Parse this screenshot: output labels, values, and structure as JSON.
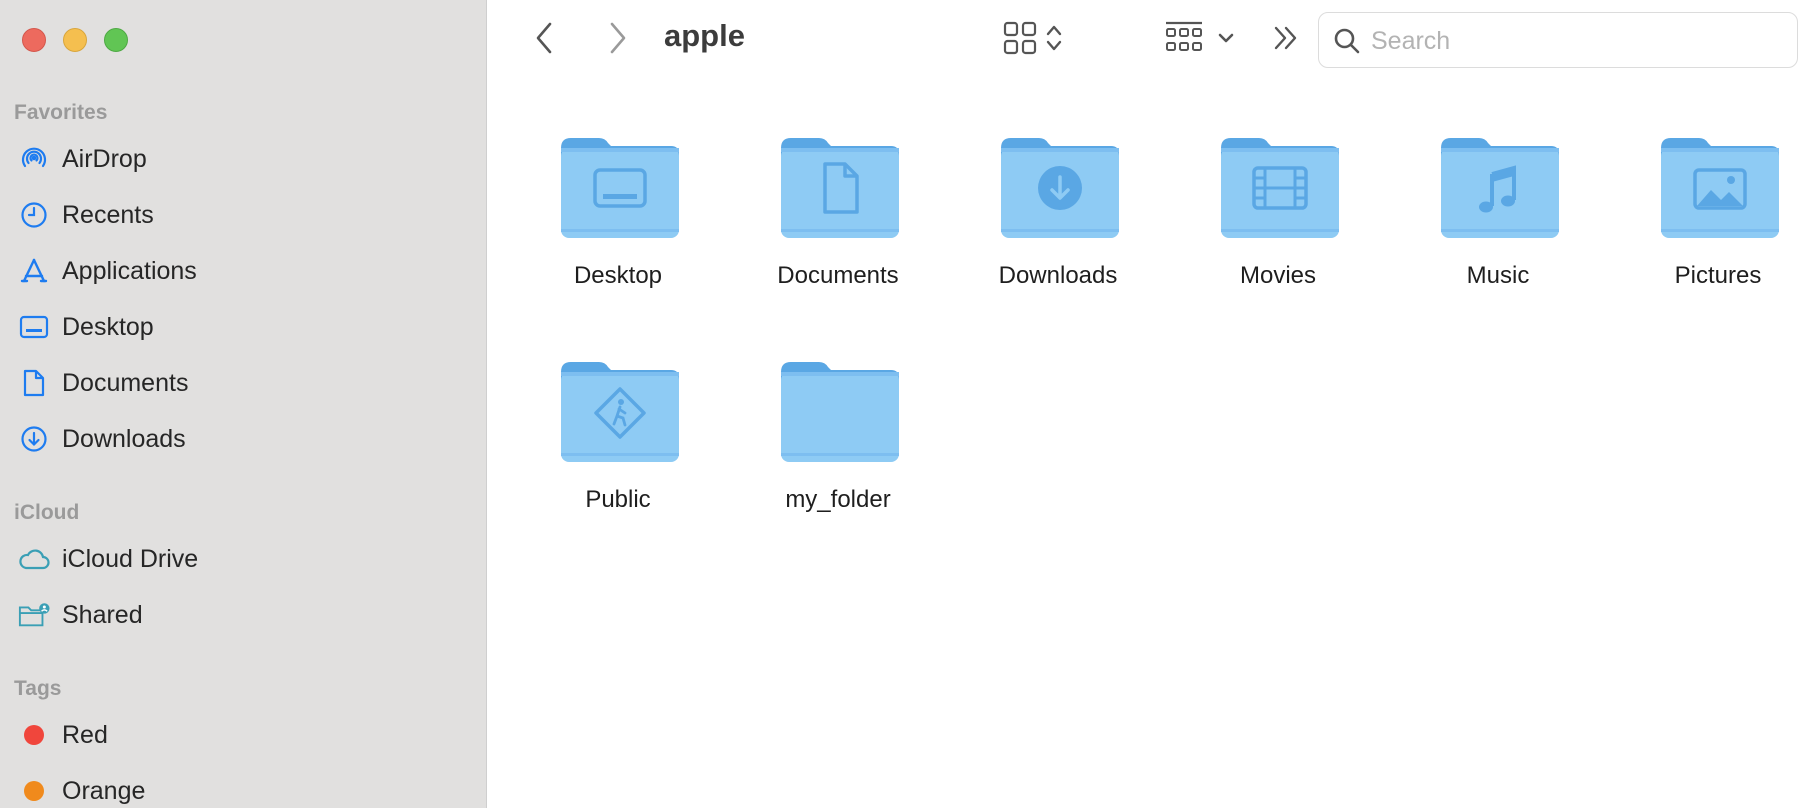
{
  "window": {
    "title": "apple"
  },
  "search": {
    "placeholder": "Search",
    "value": ""
  },
  "sidebar": {
    "favorites_title": "Favorites",
    "favorites": [
      {
        "label": "AirDrop",
        "icon": "airdrop-icon"
      },
      {
        "label": "Recents",
        "icon": "clock-icon"
      },
      {
        "label": "Applications",
        "icon": "applications-icon"
      },
      {
        "label": "Desktop",
        "icon": "desktop-icon"
      },
      {
        "label": "Documents",
        "icon": "document-icon"
      },
      {
        "label": "Downloads",
        "icon": "download-icon"
      }
    ],
    "icloud_title": "iCloud",
    "icloud": [
      {
        "label": "iCloud Drive",
        "icon": "cloud-icon"
      },
      {
        "label": "Shared",
        "icon": "shared-folder-icon"
      }
    ],
    "tags_title": "Tags",
    "tags": [
      {
        "label": "Red",
        "color": "#f0463c"
      },
      {
        "label": "Orange",
        "color": "#f08a1c"
      }
    ]
  },
  "folders": [
    {
      "name": "Desktop",
      "icon": "desktop-folder-icon"
    },
    {
      "name": "Documents",
      "icon": "documents-folder-icon"
    },
    {
      "name": "Downloads",
      "icon": "downloads-folder-icon"
    },
    {
      "name": "Movies",
      "icon": "movies-folder-icon"
    },
    {
      "name": "Music",
      "icon": "music-folder-icon"
    },
    {
      "name": "Pictures",
      "icon": "pictures-folder-icon"
    },
    {
      "name": "Public",
      "icon": "public-folder-icon"
    },
    {
      "name": "my_folder",
      "icon": "folder-icon"
    }
  ],
  "colors": {
    "accent": "#1e7cf0",
    "folder_body": "#8ecbf4",
    "folder_tab": "#5aa7e4",
    "icloud_accent": "#3a9fb5"
  }
}
